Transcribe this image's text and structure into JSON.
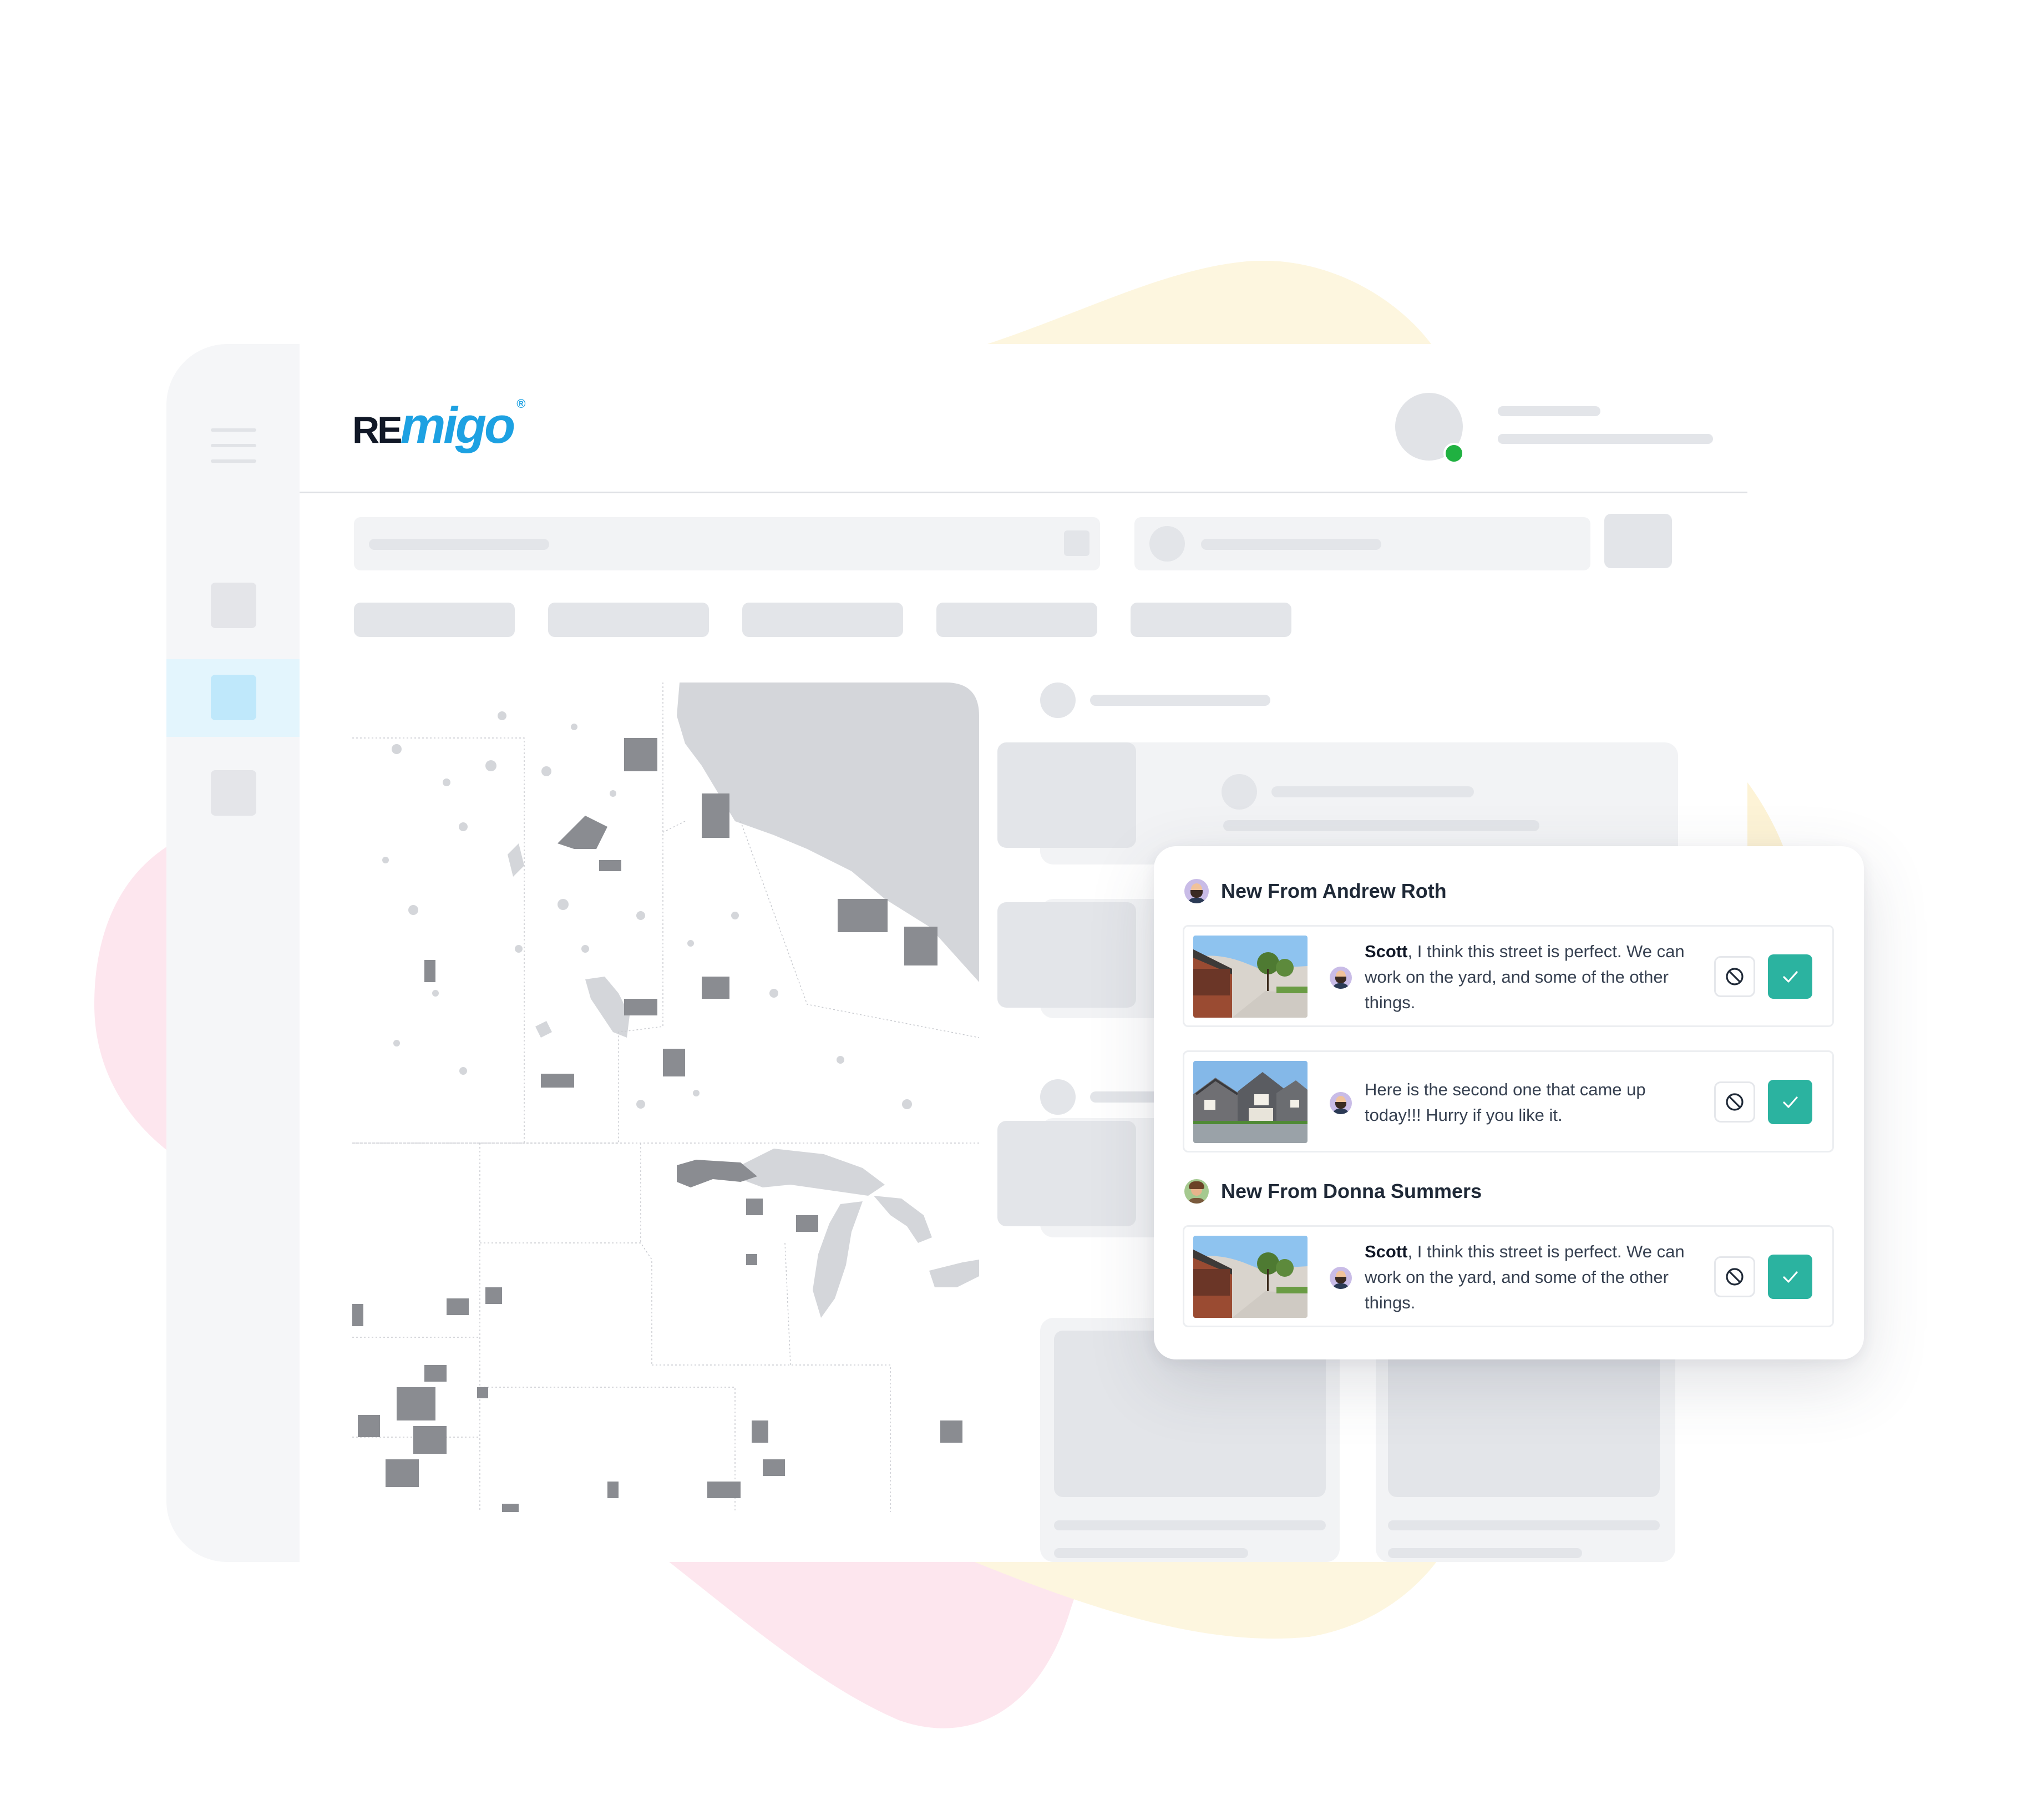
{
  "brand": {
    "logo_re": "RE",
    "logo_migo": "migo",
    "logo_reg": "®",
    "accent_color": "#1da1e2",
    "dark_color": "#111827"
  },
  "user": {
    "status": "online",
    "status_color": "#20b141"
  },
  "notifications": {
    "groups": [
      {
        "title": "New From Andrew Roth",
        "messages": [
          {
            "sender_prefix": "Scott",
            "text": ", I think this street is perfect. We can work on the yard, and some of the other things.",
            "thumbnail": "house-photo-modern-building"
          },
          {
            "sender_prefix": "",
            "text": "Here is the second one that came up today!!! Hurry if you like it.",
            "thumbnail": "house-photo-suburban-homes"
          }
        ]
      },
      {
        "title": "New From Donna Summers",
        "messages": [
          {
            "sender_prefix": "Scott",
            "text": ", I think this street is perfect. We can work on the yard, and some of the other things.",
            "thumbnail": "house-photo-modern-building"
          }
        ]
      }
    ],
    "approve_color": "#2bb3a0",
    "icons": {
      "decline": "ban-icon",
      "approve": "check-icon"
    }
  }
}
